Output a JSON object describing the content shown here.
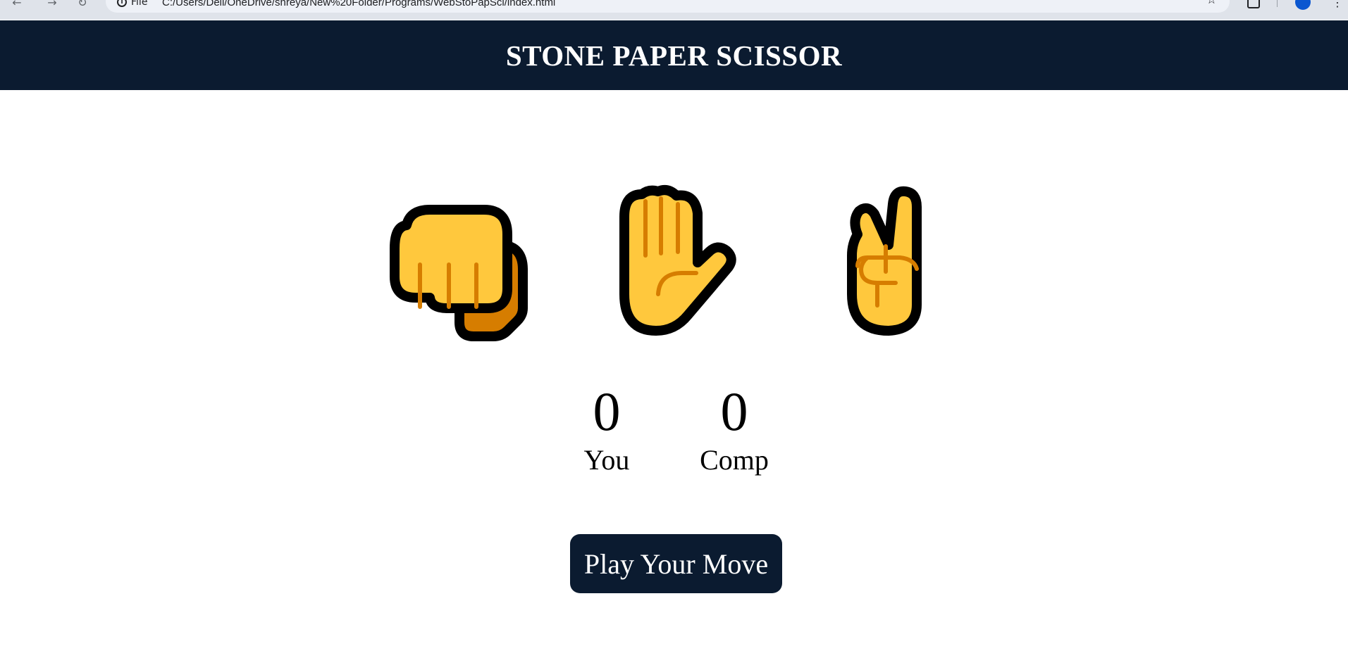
{
  "browser": {
    "site_label": "File",
    "url": "C:/Users/Dell/OneDrive/shreya/New%20Folder/Programs/WebStoPapSci/index.html"
  },
  "header": {
    "title": "STONE PAPER SCISSOR"
  },
  "choices": [
    {
      "name": "stone",
      "icon": "raised-fist-icon"
    },
    {
      "name": "paper",
      "icon": "raised-hand-icon"
    },
    {
      "name": "scissor",
      "icon": "victory-hand-icon"
    }
  ],
  "scoreboard": {
    "user": {
      "score": "0",
      "label": "You"
    },
    "comp": {
      "score": "0",
      "label": "Comp"
    }
  },
  "message": {
    "text": "Play Your Move"
  },
  "colors": {
    "header_bg": "#0b1b30",
    "emoji_yellow": "#ffc83d",
    "emoji_shadow": "#d67d00"
  }
}
